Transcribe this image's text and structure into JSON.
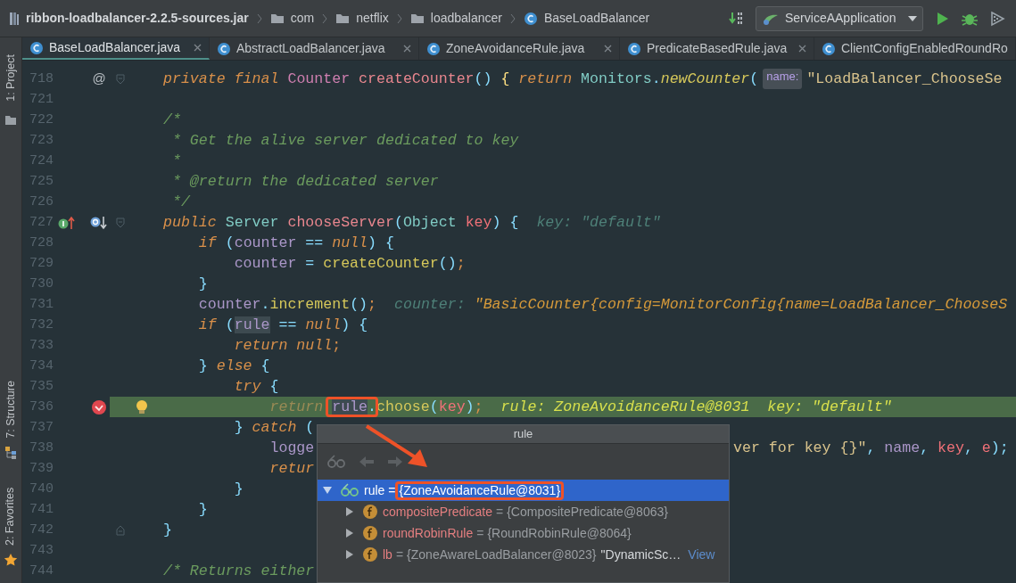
{
  "breadcrumbs": [
    {
      "kind": "jar",
      "label": "ribbon-loadbalancer-2.2.5-sources.jar"
    },
    {
      "kind": "folder",
      "label": "com"
    },
    {
      "kind": "folder",
      "label": "netflix"
    },
    {
      "kind": "folder",
      "label": "loadbalancer"
    },
    {
      "kind": "class",
      "label": "BaseLoadBalancer"
    }
  ],
  "toolbar": {
    "run_config": "ServiceAApplication",
    "buttons": [
      {
        "kind": "build"
      },
      {
        "kind": "run"
      },
      {
        "kind": "debug"
      },
      {
        "kind": "coverage"
      }
    ]
  },
  "tool_windows": [
    {
      "kind": "project",
      "label": "1: Project"
    },
    {
      "kind": "structure",
      "label": "7: Structure"
    },
    {
      "kind": "favorites",
      "label": "2: Favorites"
    }
  ],
  "tabs": [
    {
      "label": "BaseLoadBalancer.java",
      "selected": true,
      "closable": true
    },
    {
      "label": "AbstractLoadBalancer.java",
      "selected": false,
      "closable": true
    },
    {
      "label": "ZoneAvoidanceRule.java",
      "selected": false,
      "closable": true
    },
    {
      "label": "PredicateBasedRule.java",
      "selected": false,
      "closable": true
    },
    {
      "label": "ClientConfigEnabledRoundRo",
      "selected": false,
      "closable": false
    }
  ],
  "lines": [
    {
      "number": "718",
      "breakpoint": false,
      "current": false,
      "marks": [
        {
          "kind": "at",
          "text": "@"
        },
        {
          "kind": "fold_start"
        }
      ],
      "segments": [
        {
          "kind": "code",
          "tokens": [
            {
              "kind": "kw",
              "text": "private final "
            },
            {
              "kind": "type",
              "text": "Counter "
            },
            {
              "kind": "decl",
              "text": "createCounter"
            },
            {
              "kind": "pu",
              "text": "() "
            },
            {
              "kind": "yb",
              "text": "{ "
            },
            {
              "kind": "kw",
              "text": "return "
            },
            {
              "kind": "cls",
              "text": "Monitors"
            },
            {
              "kind": "pu",
              "text": "."
            },
            {
              "kind": "calli",
              "text": "newCounter"
            },
            {
              "kind": "pu",
              "text": "("
            }
          ]
        },
        {
          "kind": "chip",
          "text": "name:"
        },
        {
          "kind": "code",
          "tokens": [
            {
              "kind": "str",
              "text": "\"LoadBalancer_ChooseSe"
            }
          ]
        }
      ]
    },
    {
      "number": "721",
      "breakpoint": false,
      "current": false
    },
    {
      "number": "722",
      "breakpoint": false,
      "current": false,
      "segments": [
        {
          "kind": "code",
          "tokens": [
            {
              "kind": "cm",
              "text": "/*"
            }
          ]
        }
      ]
    },
    {
      "number": "723",
      "breakpoint": false,
      "current": false,
      "segments": [
        {
          "kind": "code",
          "tokens": [
            {
              "kind": "cm",
              "text": " * Get the alive server dedicated to key"
            }
          ]
        }
      ]
    },
    {
      "number": "724",
      "breakpoint": false,
      "current": false,
      "segments": [
        {
          "kind": "code",
          "tokens": [
            {
              "kind": "cm",
              "text": " *"
            }
          ]
        }
      ]
    },
    {
      "number": "725",
      "breakpoint": false,
      "current": false,
      "segments": [
        {
          "kind": "code",
          "tokens": [
            {
              "kind": "cm",
              "text": " * @return the dedicated server"
            }
          ]
        }
      ]
    },
    {
      "number": "726",
      "breakpoint": false,
      "current": false,
      "segments": [
        {
          "kind": "code",
          "tokens": [
            {
              "kind": "cm",
              "text": " */"
            }
          ]
        }
      ]
    },
    {
      "number": "727",
      "breakpoint": false,
      "current": false,
      "marks": [
        {
          "kind": "implements"
        },
        {
          "kind": "overridden"
        },
        {
          "kind": "fold_start"
        }
      ],
      "segments": [
        {
          "kind": "code",
          "tokens": [
            {
              "kind": "kw",
              "text": "public "
            },
            {
              "kind": "cls",
              "text": "Server "
            },
            {
              "kind": "decl",
              "text": "chooseServer"
            },
            {
              "kind": "pu",
              "text": "("
            },
            {
              "kind": "cls",
              "text": "Object "
            },
            {
              "kind": "param",
              "text": "key"
            },
            {
              "kind": "pu",
              "text": ") {"
            }
          ]
        },
        {
          "kind": "hint",
          "text": "key: \"default\""
        }
      ]
    },
    {
      "number": "728",
      "breakpoint": false,
      "current": false,
      "segments": [
        {
          "kind": "code",
          "tokens": [
            {
              "kind": "kw",
              "text": "    if "
            },
            {
              "kind": "pu",
              "text": "("
            },
            {
              "kind": "field",
              "text": "counter"
            },
            {
              "kind": "pu",
              "text": " == "
            },
            {
              "kind": "kw",
              "text": "null"
            },
            {
              "kind": "pu",
              "text": ") {"
            }
          ]
        }
      ]
    },
    {
      "number": "729",
      "breakpoint": false,
      "current": false,
      "segments": [
        {
          "kind": "code",
          "tokens": [
            {
              "kind": "field",
              "text": "        counter"
            },
            {
              "kind": "pu",
              "text": " = "
            },
            {
              "kind": "call",
              "text": "createCounter"
            },
            {
              "kind": "pu",
              "text": "()"
            },
            {
              "kind": "semi",
              "text": ";"
            }
          ]
        }
      ]
    },
    {
      "number": "730",
      "breakpoint": false,
      "current": false,
      "segments": [
        {
          "kind": "code",
          "tokens": [
            {
              "kind": "pu",
              "text": "    }"
            }
          ]
        }
      ]
    },
    {
      "number": "731",
      "breakpoint": false,
      "current": false,
      "segments": [
        {
          "kind": "code",
          "tokens": [
            {
              "kind": "field",
              "text": "    counter"
            },
            {
              "kind": "pu",
              "text": "."
            },
            {
              "kind": "call",
              "text": "increment"
            },
            {
              "kind": "pu",
              "text": "()"
            },
            {
              "kind": "semi",
              "text": ";"
            }
          ]
        },
        {
          "kind": "hint",
          "text": "counter:"
        },
        {
          "kind": "value",
          "text": "\"BasicCounter{config=MonitorConfig{name=LoadBalancer_ChooseS"
        }
      ]
    },
    {
      "number": "732",
      "breakpoint": false,
      "current": false,
      "segments": [
        {
          "kind": "code",
          "tokens": [
            {
              "kind": "kw",
              "text": "    if "
            },
            {
              "kind": "pu",
              "text": "("
            },
            {
              "kind": "fieldhl",
              "text": "rule"
            },
            {
              "kind": "pu",
              "text": " == "
            },
            {
              "kind": "kw",
              "text": "null"
            },
            {
              "kind": "pu",
              "text": ") {"
            }
          ]
        }
      ]
    },
    {
      "number": "733",
      "breakpoint": false,
      "current": false,
      "segments": [
        {
          "kind": "code",
          "tokens": [
            {
              "kind": "kw",
              "text": "        return null"
            },
            {
              "kind": "semi",
              "text": ";"
            }
          ]
        }
      ]
    },
    {
      "number": "734",
      "breakpoint": false,
      "current": false,
      "segments": [
        {
          "kind": "code",
          "tokens": [
            {
              "kind": "pu",
              "text": "    } "
            },
            {
              "kind": "kw",
              "text": "else"
            },
            {
              "kind": "pu",
              "text": " {"
            }
          ]
        }
      ]
    },
    {
      "number": "735",
      "breakpoint": false,
      "current": false,
      "segments": [
        {
          "kind": "code",
          "tokens": [
            {
              "kind": "kw",
              "text": "        try"
            },
            {
              "kind": "pu",
              "text": " {"
            }
          ]
        }
      ]
    },
    {
      "number": "736",
      "breakpoint": true,
      "current": true,
      "marks": [
        {
          "kind": "lightbulb"
        }
      ],
      "segments": [
        {
          "kind": "code",
          "tokens": [
            {
              "kind": "kwd",
              "text": "            return "
            }
          ]
        },
        {
          "kind": "code",
          "boxed": true,
          "tokens": [
            {
              "kind": "fieldhl",
              "text": "rule"
            },
            {
              "kind": "pu",
              "text": "."
            }
          ]
        },
        {
          "kind": "code",
          "tokens": [
            {
              "kind": "call",
              "text": "choose"
            },
            {
              "kind": "pu",
              "text": "("
            },
            {
              "kind": "param",
              "text": "key"
            },
            {
              "kind": "pu",
              "text": ")"
            },
            {
              "kind": "semi",
              "text": ";"
            }
          ]
        },
        {
          "kind": "current_value",
          "text": "rule: ZoneAvoidanceRule@8031  key: \"default\""
        }
      ]
    },
    {
      "number": "737",
      "breakpoint": false,
      "current": false,
      "segments": [
        {
          "kind": "code",
          "tokens": [
            {
              "kind": "pu",
              "text": "        } "
            },
            {
              "kind": "kw",
              "text": "catch"
            },
            {
              "kind": "pu",
              "text": " ("
            }
          ]
        }
      ]
    },
    {
      "number": "738",
      "breakpoint": false,
      "current": false,
      "segments": [
        {
          "kind": "code",
          "tokens": [
            {
              "kind": "field",
              "text": "            logge"
            }
          ]
        },
        {
          "kind": "right",
          "tokens": [
            {
              "kind": "str",
              "text": "ver for key {}\""
            },
            {
              "kind": "pu",
              "text": ", "
            },
            {
              "kind": "field",
              "text": "name"
            },
            {
              "kind": "pu",
              "text": ", "
            },
            {
              "kind": "param",
              "text": "key"
            },
            {
              "kind": "pu",
              "text": ", "
            },
            {
              "kind": "param",
              "text": "e"
            },
            {
              "kind": "pu",
              "text": ");"
            }
          ]
        }
      ]
    },
    {
      "number": "739",
      "breakpoint": false,
      "current": false,
      "segments": [
        {
          "kind": "code",
          "tokens": [
            {
              "kind": "kw",
              "text": "            retur"
            }
          ]
        }
      ]
    },
    {
      "number": "740",
      "breakpoint": false,
      "current": false,
      "segments": [
        {
          "kind": "code",
          "tokens": [
            {
              "kind": "pu",
              "text": "        }"
            }
          ]
        }
      ]
    },
    {
      "number": "741",
      "breakpoint": false,
      "current": false,
      "segments": [
        {
          "kind": "code",
          "tokens": [
            {
              "kind": "pu",
              "text": "    }"
            }
          ]
        }
      ]
    },
    {
      "number": "742",
      "breakpoint": false,
      "current": false,
      "marks": [
        {
          "kind": "fold_end"
        }
      ],
      "segments": [
        {
          "kind": "code",
          "tokens": [
            {
              "kind": "pu",
              "text": "}"
            }
          ]
        }
      ]
    },
    {
      "number": "743",
      "breakpoint": false,
      "current": false
    },
    {
      "number": "744",
      "breakpoint": false,
      "current": false,
      "segments": [
        {
          "kind": "code",
          "tokens": [
            {
              "kind": "cm",
              "text": "/* Returns either"
            }
          ]
        }
      ]
    }
  ],
  "popup": {
    "title": "rule",
    "toolbar": [
      {
        "kind": "watch",
        "disabled": true
      },
      {
        "kind": "back",
        "disabled": true
      },
      {
        "kind": "forward",
        "disabled": true
      }
    ],
    "tree": [
      {
        "kind": "watch",
        "name": "rule",
        "operator": "=",
        "value": "{ZoneAvoidanceRule@8031}",
        "selected": true,
        "expanded": true,
        "boxed": true,
        "children": [
          {
            "kind": "field",
            "name": "compositePredicate",
            "operator": "=",
            "value": "{CompositePredicate@8063}",
            "selected": false,
            "expanded": false
          },
          {
            "kind": "field",
            "name": "roundRobinRule",
            "operator": "=",
            "value": "{RoundRobinRule@8064}",
            "selected": false,
            "expanded": false
          },
          {
            "kind": "field",
            "name": "lb",
            "operator": "=",
            "value": "{ZoneAwareLoadBalancer@8023}",
            "extra": "\"DynamicSc…",
            "link": "View",
            "selected": false,
            "expanded": false
          }
        ]
      }
    ]
  }
}
